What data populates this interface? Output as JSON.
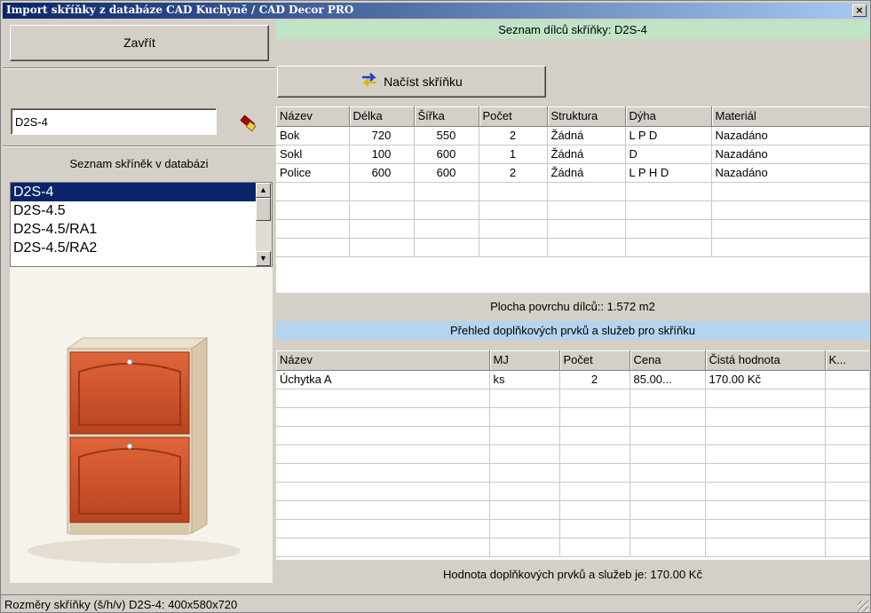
{
  "window": {
    "title": "Import skříňky z databáze CAD Kuchyně / CAD Decor PRO",
    "close_glyph": "×"
  },
  "left": {
    "close_button": "Zavřít",
    "search_value": "D2S-4",
    "search_icon": "eraser-icon",
    "list_header": "Seznam skříněk v databázi",
    "cabinets": [
      "D2S-4",
      "D2S-4.5",
      "D2S-4.5/RA1",
      "D2S-4.5/RA2"
    ],
    "selected_index": 0
  },
  "parts": {
    "header": "Seznam dílců skříňky: D2S-4",
    "load_button": "Načíst skříňku",
    "load_icon": "swap-arrows-icon",
    "columns": [
      "Název",
      "Délka",
      "Šířka",
      "Počet",
      "Struktura",
      "Dýha",
      "Materiál"
    ],
    "rows": [
      [
        "Bok",
        "720",
        "550",
        "2",
        "Žádná",
        "L P D",
        "Nazadáno"
      ],
      [
        "Sokl",
        "100",
        "600",
        "1",
        "Žádná",
        "D",
        "Nazadáno"
      ],
      [
        "Police",
        "600",
        "600",
        "2",
        "Žádná",
        "L P H D",
        "Nazadáno"
      ],
      [
        "",
        "",
        "",
        "",
        "",
        "",
        ""
      ],
      [
        "",
        "",
        "",
        "",
        "",
        "",
        ""
      ],
      [
        "",
        "",
        "",
        "",
        "",
        "",
        ""
      ],
      [
        "",
        "",
        "",
        "",
        "",
        "",
        ""
      ]
    ],
    "surface_text": "Plocha povrchu dílců:: 1.572 m2"
  },
  "extras": {
    "header": "Přehled doplňkových prvků a služeb pro skříňku",
    "columns": [
      "Název",
      "MJ",
      "Počet",
      "Cena",
      "Čistá hodnota",
      "K..."
    ],
    "rows": [
      [
        "Úchytka A",
        "ks",
        "2",
        "85.00...",
        "170.00 Kč",
        ""
      ],
      [
        "",
        "",
        "",
        "",
        "",
        ""
      ],
      [
        "",
        "",
        "",
        "",
        "",
        ""
      ],
      [
        "",
        "",
        "",
        "",
        "",
        ""
      ],
      [
        "",
        "",
        "",
        "",
        "",
        ""
      ],
      [
        "",
        "",
        "",
        "",
        "",
        ""
      ],
      [
        "",
        "",
        "",
        "",
        "",
        ""
      ],
      [
        "",
        "",
        "",
        "",
        "",
        ""
      ],
      [
        "",
        "",
        "",
        "",
        "",
        ""
      ],
      [
        "",
        "",
        "",
        "",
        "",
        ""
      ]
    ],
    "total_text": "Hodnota doplňkových prvků a služeb je: 170.00 Kč"
  },
  "status": {
    "text": "Rozměry skříňky (š/h/v) D2S-4: 400x580x720"
  },
  "colors": {
    "titlebar": "#0a246a",
    "selection": "#0a246a",
    "parts_header": "#bfe4c6",
    "extras_header": "#b4d4f0",
    "cabinet_front": "#d2532a",
    "cabinet_body": "#e8d9c0"
  }
}
